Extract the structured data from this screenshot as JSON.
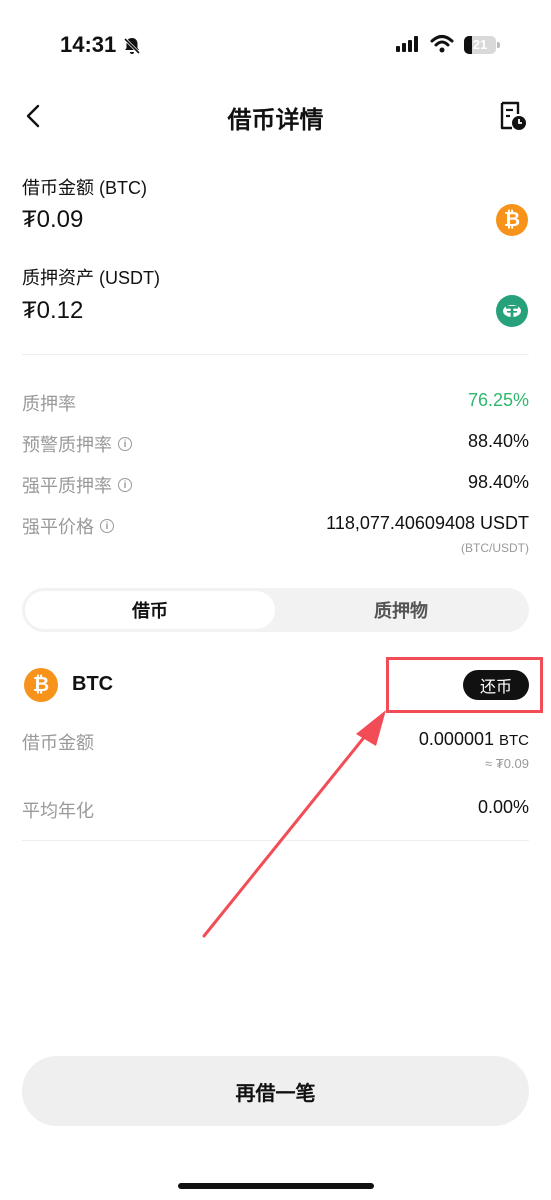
{
  "status_bar": {
    "time": "14:31",
    "battery": "21"
  },
  "header": {
    "title": "借币详情"
  },
  "summary": {
    "borrow_label": "借币金额 (BTC)",
    "borrow_value": "₮0.09",
    "collateral_label": "质押资产 (USDT)",
    "collateral_value": "₮0.12"
  },
  "metrics": {
    "ltv_label": "质押率",
    "ltv_value": "76.25%",
    "warning_label": "预警质押率",
    "warning_value": "88.40%",
    "liq_label": "强平质押率",
    "liq_value": "98.40%",
    "liq_price_label": "强平价格",
    "liq_price_value": "118,077.40609408 USDT",
    "liq_price_pair": "(BTC/USDT)"
  },
  "tabs": [
    {
      "label": "借币",
      "active": true
    },
    {
      "label": "质押物",
      "active": false
    }
  ],
  "asset": {
    "symbol": "BTC",
    "repay_label": "还币",
    "borrow_amount_label": "借币金额",
    "borrow_amount_value": "0.000001",
    "borrow_amount_unit": "BTC",
    "borrow_amount_approx": "≈ ₮0.09",
    "apr_label": "平均年化",
    "apr_value": "0.00%"
  },
  "cta": {
    "label": "再借一笔"
  },
  "colors": {
    "positive": "#2fb86b",
    "btc": "#f7931a",
    "usdt": "#26a17b",
    "highlight": "#f24d57"
  },
  "icons": [
    "bell-off-icon",
    "signal-icon",
    "wifi-icon",
    "battery-icon",
    "back-icon",
    "history-icon",
    "btc-coin-icon",
    "usdt-coin-icon",
    "info-icon"
  ]
}
